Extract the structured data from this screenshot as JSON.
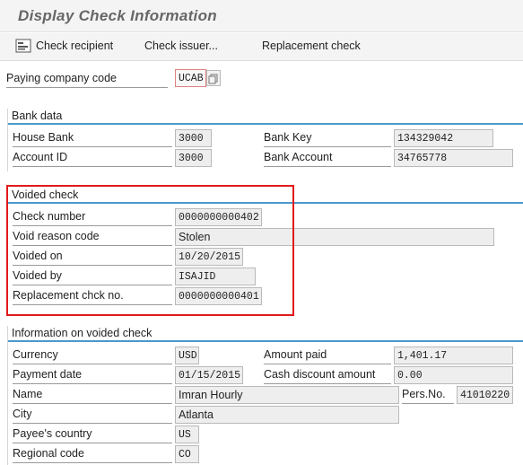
{
  "window": {
    "title": "Display Check Information"
  },
  "toolbar": {
    "check_recipient": "Check recipient",
    "check_issuer": "Check issuer...",
    "replacement_check": "Replacement check"
  },
  "header": {
    "paying_company_code_label": "Paying company code",
    "paying_company_code_value": "UCAB"
  },
  "bank_data": {
    "title": "Bank data",
    "house_bank_label": "House Bank",
    "house_bank_value": "3000",
    "bank_key_label": "Bank Key",
    "bank_key_value": "134329042",
    "account_id_label": "Account ID",
    "account_id_value": "3000",
    "bank_account_label": "Bank Account",
    "bank_account_value": "34765778"
  },
  "voided_check": {
    "title": "Voided check",
    "check_number_label": "Check number",
    "check_number_value": "0000000000402",
    "void_reason_label": "Void reason code",
    "void_reason_value": "Stolen",
    "voided_on_label": "Voided on",
    "voided_on_value": "10/20/2015",
    "voided_by_label": "Voided by",
    "voided_by_value": "ISAJID",
    "replacement_label": "Replacement chck no.",
    "replacement_value": "0000000000401"
  },
  "info_voided": {
    "title": "Information on voided check",
    "currency_label": "Currency",
    "currency_value": "USD",
    "amount_paid_label": "Amount paid",
    "amount_paid_value": "1,401.17",
    "payment_date_label": "Payment date",
    "payment_date_value": "01/15/2015",
    "cash_discount_label": "Cash discount amount",
    "cash_discount_value": "0.00",
    "name_label": "Name",
    "name_value": "Imran Hourly",
    "pers_no_label": "Pers.No.",
    "pers_no_value": "41010220",
    "city_label": "City",
    "city_value": "Atlanta",
    "payee_country_label": "Payee's country",
    "payee_country_value": "US",
    "regional_code_label": "Regional code",
    "regional_code_value": "CO"
  },
  "colors": {
    "highlight": "#e01a1a",
    "section_rule": "#4a9ac9"
  }
}
